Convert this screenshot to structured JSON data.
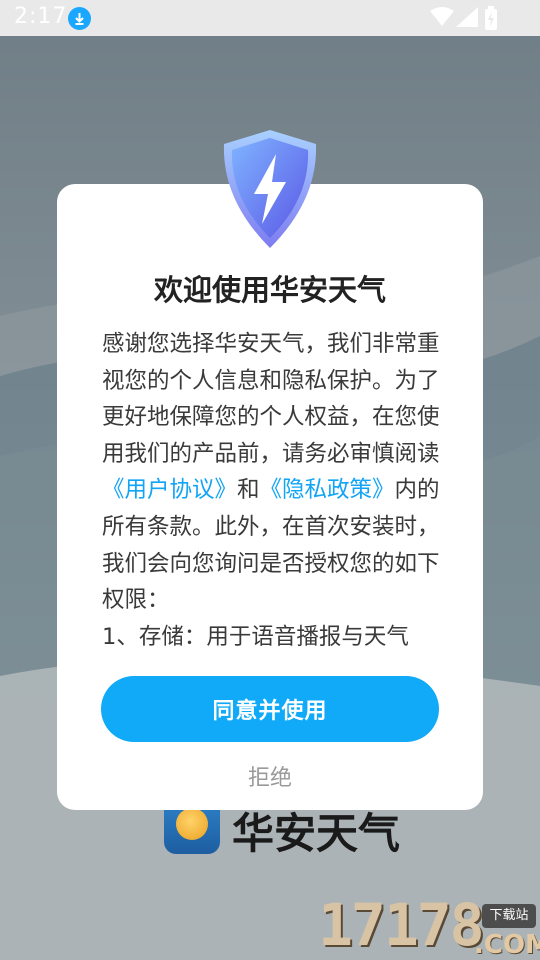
{
  "status_bar": {
    "time": "2:17",
    "icons": [
      "download-icon",
      "wifi-icon",
      "signal-icon",
      "battery-icon"
    ]
  },
  "background_app": {
    "app_name": "华安天气"
  },
  "dialog": {
    "title": "欢迎使用华安天气",
    "body_segments": {
      "part1": "感谢您选择华安天气，我们非常重视您的个人信息和隐私保护。为了更好地保障您的个人权益，在您使用我们的产品前，请务必审慎阅读",
      "link_user_agreement": "《用户协议》",
      "conjunction": "和",
      "link_privacy_policy": "《隐私政策》",
      "part2": "内的所有条款。此外，在首次安装时，我们会向您询问是否授权您的如下权限：",
      "permission_1": "1、存储：用于语音播报与天气"
    },
    "agree_label": "同意并使用",
    "reject_label": "拒绝"
  },
  "watermark": {
    "number": "17178",
    "tag": "下载站",
    "suffix": ".COM"
  },
  "colors": {
    "accent": "#10aaf8",
    "link": "#12a4f5",
    "download_badge": "#1aa7ff"
  }
}
